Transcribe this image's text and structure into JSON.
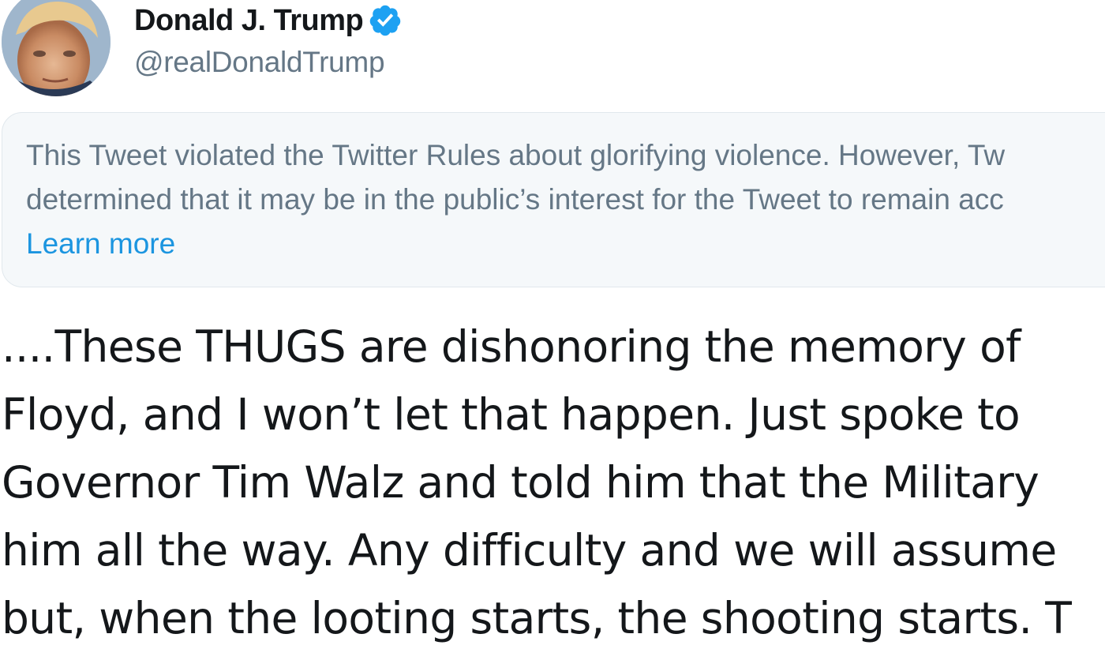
{
  "tweet": {
    "author": {
      "display_name": "Donald J. Trump",
      "handle": "@realDonaldTrump",
      "verified": true,
      "avatar_icon": "profile-photo",
      "verified_icon": "verified-badge-icon"
    },
    "notice": {
      "lines": [
        "This Tweet violated the Twitter Rules about glorifying violence. However, Tw",
        "determined that it may be in the public’s interest for the Tweet to remain acc"
      ],
      "link_label": "Learn more"
    },
    "text_lines": [
      "....These THUGS are dishonoring the memory of",
      "Floyd, and I won’t let that happen. Just spoke to",
      "Governor Tim Walz and told him that the Military",
      "him all the way. Any difficulty and we will assume",
      "but, when the looting starts, the shooting starts. T"
    ]
  },
  "colors": {
    "name": "#14171a",
    "handle": "#657786",
    "notice_bg": "#f5f8fa",
    "notice_border": "#e1e8ed",
    "notice_text": "#657786",
    "link": "#1b95e0",
    "verified": "#1da1f2",
    "tweet_text": "#14171a"
  }
}
